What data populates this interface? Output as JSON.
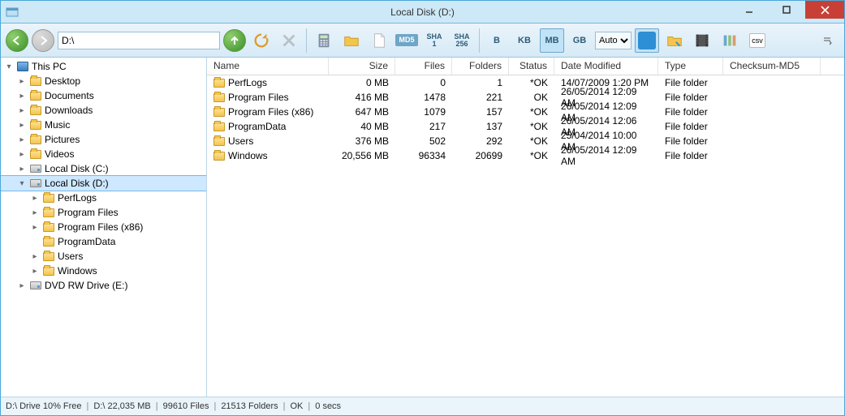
{
  "window": {
    "title": "Local Disk (D:)"
  },
  "path_value": "D:\\",
  "toolbar": {
    "hash_buttons": [
      "MD5",
      "SHA\n1",
      "SHA\n256"
    ],
    "unit_buttons": [
      "B",
      "KB",
      "MB",
      "GB"
    ],
    "unit_active": "MB",
    "auto_select": "Auto",
    "csv_label": "csv"
  },
  "tree": [
    {
      "depth": 0,
      "twisty": "▾",
      "icon": "pc",
      "label": "This PC",
      "sel": false
    },
    {
      "depth": 1,
      "twisty": "▸",
      "icon": "folder",
      "label": "Desktop",
      "sel": false
    },
    {
      "depth": 1,
      "twisty": "▸",
      "icon": "folder",
      "label": "Documents",
      "sel": false
    },
    {
      "depth": 1,
      "twisty": "▸",
      "icon": "folder",
      "label": "Downloads",
      "sel": false
    },
    {
      "depth": 1,
      "twisty": "▸",
      "icon": "folder",
      "label": "Music",
      "sel": false
    },
    {
      "depth": 1,
      "twisty": "▸",
      "icon": "folder",
      "label": "Pictures",
      "sel": false
    },
    {
      "depth": 1,
      "twisty": "▸",
      "icon": "folder",
      "label": "Videos",
      "sel": false
    },
    {
      "depth": 1,
      "twisty": "▸",
      "icon": "drive",
      "label": "Local Disk (C:)",
      "sel": false
    },
    {
      "depth": 1,
      "twisty": "▾",
      "icon": "drive",
      "label": "Local Disk (D:)",
      "sel": true
    },
    {
      "depth": 2,
      "twisty": "▸",
      "icon": "folder",
      "label": "PerfLogs",
      "sel": false
    },
    {
      "depth": 2,
      "twisty": "▸",
      "icon": "folder",
      "label": "Program Files",
      "sel": false
    },
    {
      "depth": 2,
      "twisty": "▸",
      "icon": "folder",
      "label": "Program Files (x86)",
      "sel": false
    },
    {
      "depth": 2,
      "twisty": "",
      "icon": "folder",
      "label": "ProgramData",
      "sel": false
    },
    {
      "depth": 2,
      "twisty": "▸",
      "icon": "folder",
      "label": "Users",
      "sel": false
    },
    {
      "depth": 2,
      "twisty": "▸",
      "icon": "folder",
      "label": "Windows",
      "sel": false
    },
    {
      "depth": 1,
      "twisty": "▸",
      "icon": "drive",
      "label": "DVD RW Drive (E:)",
      "sel": false
    }
  ],
  "columns": [
    "Name",
    "Size",
    "Files",
    "Folders",
    "Status",
    "Date Modified",
    "Type",
    "Checksum-MD5"
  ],
  "rows": [
    {
      "name": "PerfLogs",
      "size": "0 MB",
      "files": "0",
      "folders": "1",
      "status": "*OK",
      "date": "14/07/2009 1:20 PM",
      "type": "File folder"
    },
    {
      "name": "Program Files",
      "size": "416 MB",
      "files": "1478",
      "folders": "221",
      "status": "OK",
      "date": "26/05/2014 12:09 AM",
      "type": "File folder"
    },
    {
      "name": "Program Files (x86)",
      "size": "647 MB",
      "files": "1079",
      "folders": "157",
      "status": "*OK",
      "date": "26/05/2014 12:09 AM",
      "type": "File folder"
    },
    {
      "name": "ProgramData",
      "size": "40 MB",
      "files": "217",
      "folders": "137",
      "status": "*OK",
      "date": "26/05/2014 12:06 AM",
      "type": "File folder"
    },
    {
      "name": "Users",
      "size": "376 MB",
      "files": "502",
      "folders": "292",
      "status": "*OK",
      "date": "25/04/2014 10:00 AM",
      "type": "File folder"
    },
    {
      "name": "Windows",
      "size": "20,556 MB",
      "files": "96334",
      "folders": "20699",
      "status": "*OK",
      "date": "26/05/2014 12:09 AM",
      "type": "File folder"
    }
  ],
  "status": {
    "drive": "D:\\ Drive 10% Free",
    "total_size": "D:\\ 22,035  MB",
    "files": "99610 Files",
    "folders": "21513 Folders",
    "ok": "OK",
    "secs": "0 secs"
  }
}
